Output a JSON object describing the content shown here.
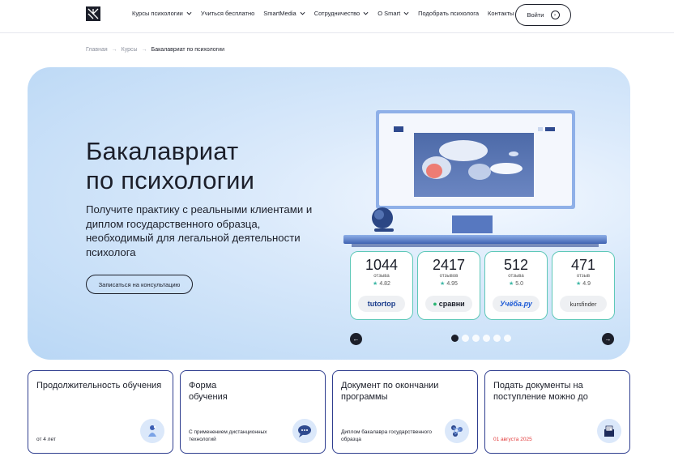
{
  "header": {
    "nav": [
      {
        "label": "Курсы психологии",
        "dropdown": true
      },
      {
        "label": "Учиться бесплатно",
        "dropdown": false
      },
      {
        "label": "SmartMedia",
        "dropdown": true
      },
      {
        "label": "Сотрудничество",
        "dropdown": true
      },
      {
        "label": "О Smart",
        "dropdown": true
      },
      {
        "label": "Подобрать психолога",
        "dropdown": false
      },
      {
        "label": "Контакты",
        "dropdown": false
      }
    ],
    "login_label": "Войти"
  },
  "breadcrumb": {
    "items": [
      "Главная",
      "Курсы",
      "Бакалавриат по психологии"
    ],
    "separator": "→"
  },
  "hero": {
    "title_line1": "Бакалавриат",
    "title_line2": "по психологии",
    "subtitle": "Получите практику с реальными клиентами и диплом государственного образца, необходимый для легальной деятельности психолога",
    "cta_label": "Записаться на консультацию",
    "ratings": [
      {
        "count": "1044",
        "label": "отзыва",
        "score": "4.82",
        "brand": "tutortop"
      },
      {
        "count": "2417",
        "label": "отзывов",
        "score": "4.95",
        "brand": "сравни"
      },
      {
        "count": "512",
        "label": "отзыва",
        "score": "5.0",
        "brand": "Учёба.ру"
      },
      {
        "count": "471",
        "label": "отзыв",
        "score": "4.9",
        "brand": "kursfinder"
      }
    ],
    "carousel": {
      "total_dots": 6,
      "active_index": 0
    }
  },
  "info_cards": [
    {
      "title": "Продолжительность обучения",
      "value": "от 4 лет",
      "icon": "calendar-person-icon",
      "accent": false
    },
    {
      "title": "Форма обучения",
      "value": "С применением дистанционных технологий",
      "icon": "chat-cloud-icon",
      "accent": false
    },
    {
      "title": "Документ по окончании программы",
      "value": "Диплом бакалавра государственного образца",
      "icon": "diploma-icon",
      "accent": false
    },
    {
      "title": "Подать документы на поступление можно до",
      "value": "01 августа 2025",
      "icon": "documents-box-icon",
      "accent": true
    }
  ],
  "colors": {
    "accent_dark": "#1c1f2a",
    "card_border": "#2f3e8f",
    "rating_border": "#5ec8b8",
    "deadline_red": "#e23b3b"
  }
}
